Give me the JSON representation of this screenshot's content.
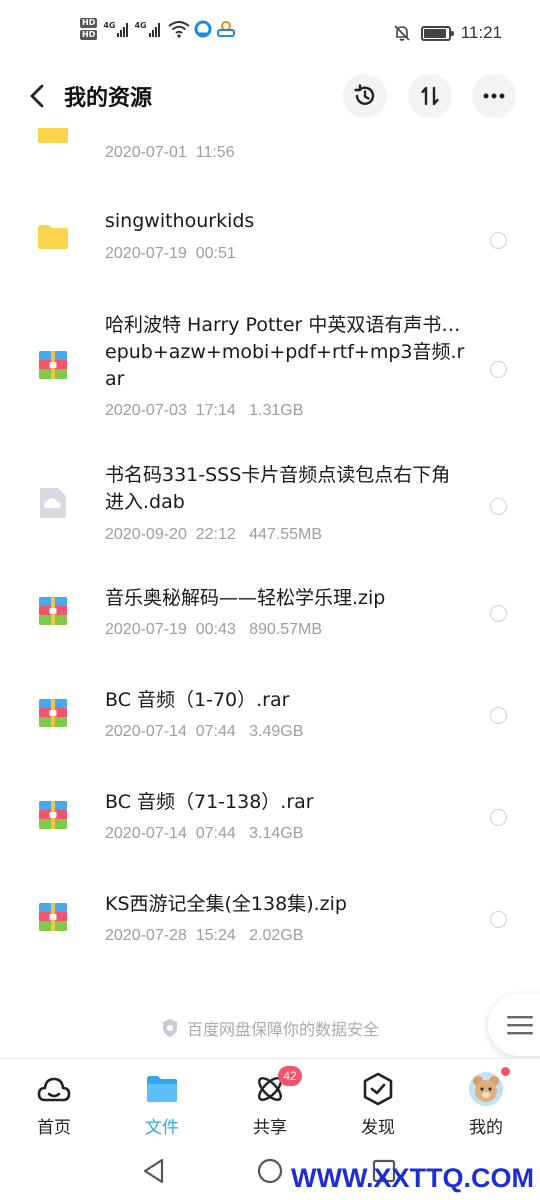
{
  "status_bar": {
    "hd1": "HD",
    "hd2": "HD",
    "net1": "4G",
    "net2": "4G",
    "time": "11:21",
    "battery_level": 0.85
  },
  "header": {
    "title": "我的资源",
    "back_icon": "chevron-left-icon",
    "history_icon": "history-icon",
    "sort_icon": "sort-icon",
    "more_icon": "more-icon"
  },
  "files": [
    {
      "name": "",
      "meta": "2020-07-01  11:56",
      "icon": "folder-icon"
    },
    {
      "name": "singwithourkids",
      "meta": "2020-07-19  00:51",
      "icon": "folder-icon"
    },
    {
      "name": "哈利波特 Harry Potter 中英双语有声书…epub+azw+mobi+pdf+rtf+mp3音频.rar",
      "meta": "2020-07-03  17:14   1.31GB",
      "icon": "archive-icon"
    },
    {
      "name": "书名码331-SSS卡片音频点读包点右下角进入.dab",
      "meta": "2020-09-20  22:12   447.55MB",
      "icon": "cloud-file-icon"
    },
    {
      "name": "音乐奥秘解码——轻松学乐理.zip",
      "meta": "2020-07-19  00:43   890.57MB",
      "icon": "archive-icon"
    },
    {
      "name": "BC 音频（1-70）.rar",
      "meta": "2020-07-14  07:44   3.49GB",
      "icon": "archive-icon"
    },
    {
      "name": "BC 音频（71-138）.rar",
      "meta": "2020-07-14  07:44   3.14GB",
      "icon": "archive-icon"
    },
    {
      "name": "KS西游记全集(全138集).zip",
      "meta": "2020-07-28  15:24   2.02GB",
      "icon": "archive-icon"
    }
  ],
  "footer_note": "百度网盘保障你的数据安全",
  "tabs": [
    {
      "label": "首页",
      "icon": "home-cloud-icon"
    },
    {
      "label": "文件",
      "icon": "folder-icon",
      "active": true
    },
    {
      "label": "共享",
      "icon": "share-atom-icon",
      "badge": "42"
    },
    {
      "label": "发现",
      "icon": "discover-box-icon"
    },
    {
      "label": "我的",
      "icon": "avatar-icon"
    }
  ],
  "watermark": "WWW.XXTTQ.COM",
  "colors": {
    "accent": "#2fa8f0",
    "badge": "#f2546b",
    "folder": "#fcd34d",
    "meta_text": "#9a9ea6"
  }
}
